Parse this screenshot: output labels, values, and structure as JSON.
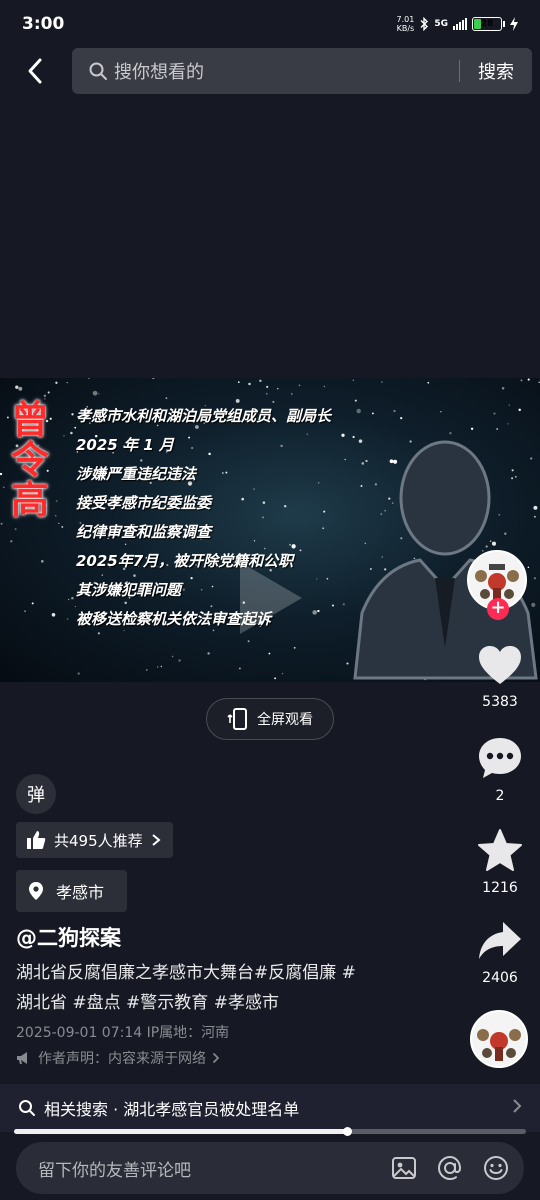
{
  "status": {
    "time": "3:00",
    "netspeed_value": "7.01",
    "netspeed_unit": "KB/s",
    "network": "5G",
    "battery": "28",
    "battery_level": 0.28
  },
  "search": {
    "placeholder": "搜你想看的",
    "button": "搜索"
  },
  "video": {
    "title_chars": [
      "曾",
      "令",
      "高"
    ],
    "lines": [
      "孝感市水利和湖泊局党组成员、副局长",
      "2025 年 1 月",
      "涉嫌严重违纪违法",
      "接受孝感市纪委监委",
      "纪律审查和监察调查",
      "2025年7月，被开除党籍和公职",
      "其涉嫌犯罪问题",
      "被移送检察机关依法审查起诉"
    ]
  },
  "actions": {
    "like_count": "5383",
    "comment_count": "2",
    "favorite_count": "1216",
    "share_count": "2406",
    "follow_symbol": "+"
  },
  "fullscreen": {
    "label": "全屏观看"
  },
  "danmu": {
    "label": "弹"
  },
  "recommend": {
    "label": "共495人推荐"
  },
  "location": {
    "label": "孝感市"
  },
  "post": {
    "author": "@二狗探案",
    "description_line1": "湖北省反腐倡廉之孝感市大舞台#反腐倡廉 #",
    "description_line2": "湖北省 #盘点 #警示教育 #孝感市",
    "meta": "2025-09-01 07:14  IP属地：河南",
    "statement": "作者声明：内容来源于网络"
  },
  "related": {
    "label": "相关搜索 · 湖北孝感官员被处理名单"
  },
  "progress": {
    "fraction": 0.65
  },
  "comment": {
    "placeholder": "留下你的友善评论吧"
  },
  "colors": {
    "background": "#161823",
    "accent": "#fe2c55",
    "title_red": "#ff2a2a",
    "battery_green": "#3ccf4e"
  },
  "icons": {
    "back": "chevron-left-icon",
    "search": "search-icon",
    "like": "heart-icon",
    "comment": "comment-icon",
    "favorite": "star-icon",
    "share": "share-icon",
    "image": "image-icon",
    "at": "at-icon",
    "emoji": "emoji-icon"
  }
}
